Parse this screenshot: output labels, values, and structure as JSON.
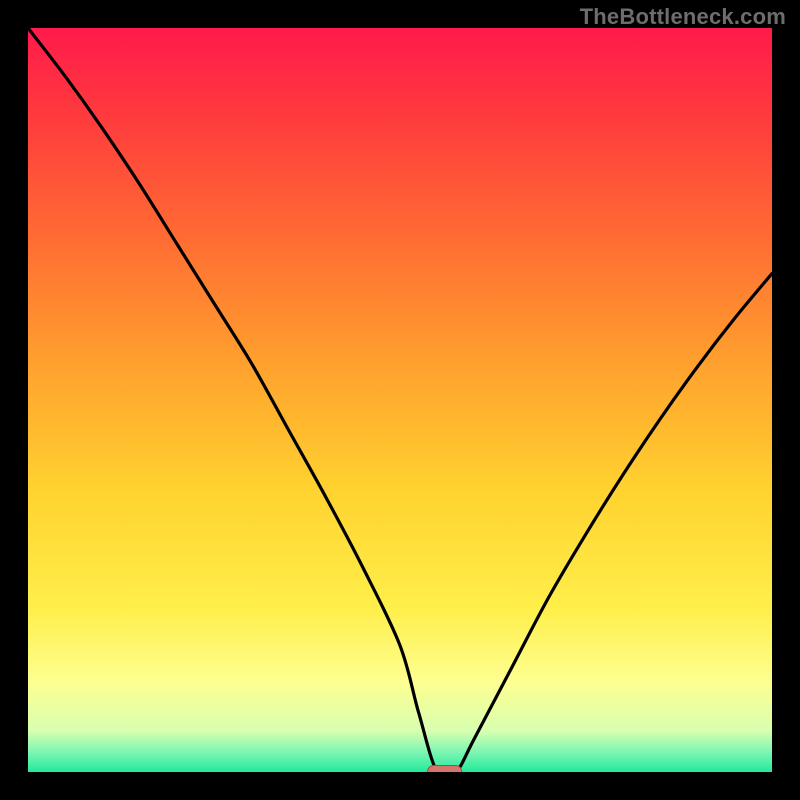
{
  "attribution": "TheBottleneck.com",
  "chart_data": {
    "type": "line",
    "title": "",
    "xlabel": "",
    "ylabel": "",
    "xlim": [
      0,
      1
    ],
    "ylim": [
      0,
      1
    ],
    "x": [
      0.0,
      0.05,
      0.1,
      0.15,
      0.2,
      0.25,
      0.3,
      0.35,
      0.4,
      0.45,
      0.5,
      0.525,
      0.55,
      0.575,
      0.6,
      0.65,
      0.7,
      0.75,
      0.8,
      0.85,
      0.9,
      0.95,
      1.0
    ],
    "values": [
      1.0,
      0.935,
      0.865,
      0.79,
      0.71,
      0.63,
      0.55,
      0.46,
      0.37,
      0.275,
      0.17,
      0.08,
      0.0,
      0.0,
      0.045,
      0.14,
      0.235,
      0.32,
      0.4,
      0.475,
      0.545,
      0.61,
      0.67
    ],
    "marker": {
      "x": 0.56,
      "y": 0.0
    },
    "gradient_stops": [
      {
        "t": 0.0,
        "color": "#ff1a4b"
      },
      {
        "t": 0.12,
        "color": "#ff3b3d"
      },
      {
        "t": 0.28,
        "color": "#ff6b33"
      },
      {
        "t": 0.45,
        "color": "#ffa02e"
      },
      {
        "t": 0.62,
        "color": "#ffd22f"
      },
      {
        "t": 0.78,
        "color": "#ffef4a"
      },
      {
        "t": 0.88,
        "color": "#fdff91"
      },
      {
        "t": 0.945,
        "color": "#d8ffb0"
      },
      {
        "t": 0.975,
        "color": "#77f5b2"
      },
      {
        "t": 1.0,
        "color": "#22e99a"
      }
    ],
    "curve_color": "#000000",
    "marker_fill": "#d4766b",
    "marker_stroke": "#9f4c45"
  }
}
